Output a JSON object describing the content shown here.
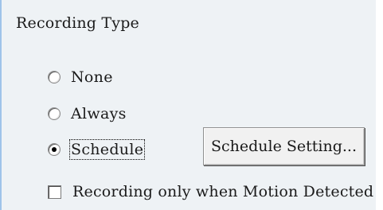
{
  "group": {
    "title": "Recording Type"
  },
  "options": [
    {
      "label": "None",
      "selected": false
    },
    {
      "label": "Always",
      "selected": false
    },
    {
      "label": "Schedule",
      "selected": true
    }
  ],
  "schedule_button": {
    "label": "Schedule Setting..."
  },
  "motion_checkbox": {
    "label": "Recording only when Motion Detected",
    "checked": false
  }
}
